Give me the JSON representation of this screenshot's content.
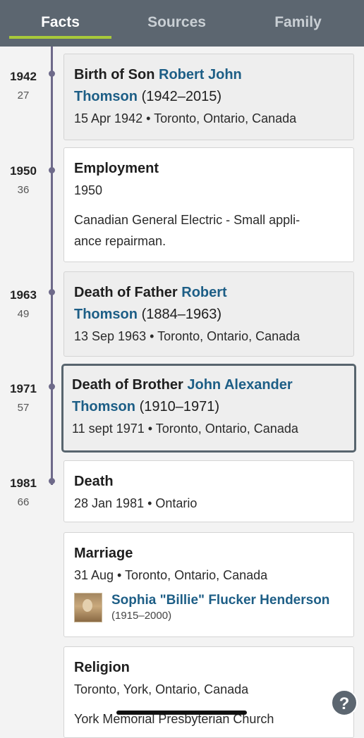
{
  "tabs": [
    {
      "label": "Facts",
      "active": true
    },
    {
      "label": "Sources",
      "active": false
    },
    {
      "label": "Family",
      "active": false
    }
  ],
  "timeline": [
    {
      "year": "1942",
      "age": "27"
    },
    {
      "year": "1950",
      "age": "36"
    },
    {
      "year": "1963",
      "age": "49"
    },
    {
      "year": "1971",
      "age": "57"
    },
    {
      "year": "1981",
      "age": "66"
    }
  ],
  "facts": {
    "birth_son": {
      "title": "Birth of Son",
      "person_first": "Robert John",
      "person_last": "Thomson",
      "dates": "(1942–2015)",
      "detail": "15 Apr 1942 • Toronto, Ontario, Canada"
    },
    "employment": {
      "title": "Employment",
      "date": "1950",
      "description_line1": "Canadian General Electric - Small appli-",
      "description_line2": "ance repairman."
    },
    "death_father": {
      "title": "Death of Father",
      "person_first": "Robert",
      "person_last": "Thomson",
      "dates": "(1884–1963)",
      "detail": "13 Sep 1963 • Toronto, Ontario, Canada"
    },
    "death_brother": {
      "title": "Death of Brother",
      "person_first": "John Alexander",
      "person_last": "Thomson",
      "dates": "(1910–1971)",
      "detail": "11 sept 1971 • Toronto, Ontario, Canada"
    },
    "death": {
      "title": "Death",
      "detail": "28 Jan 1981 • Ontario"
    },
    "marriage": {
      "title": "Marriage",
      "detail": "31 Aug • Toronto, Ontario, Canada",
      "spouse_name": "Sophia \"Billie\" Flucker Henderson",
      "spouse_dates": "(1915–2000)"
    },
    "religion": {
      "title": "Religion",
      "detail": "Toronto, York, Ontario, Canada",
      "description": "York Memorial Presbyterian Church"
    }
  },
  "help": {
    "label": "?"
  },
  "colors": {
    "tabbar": "#5c6670",
    "tab_underline": "#a8c93a",
    "link": "#1d5e86",
    "timeline": "#6e6a8a"
  }
}
